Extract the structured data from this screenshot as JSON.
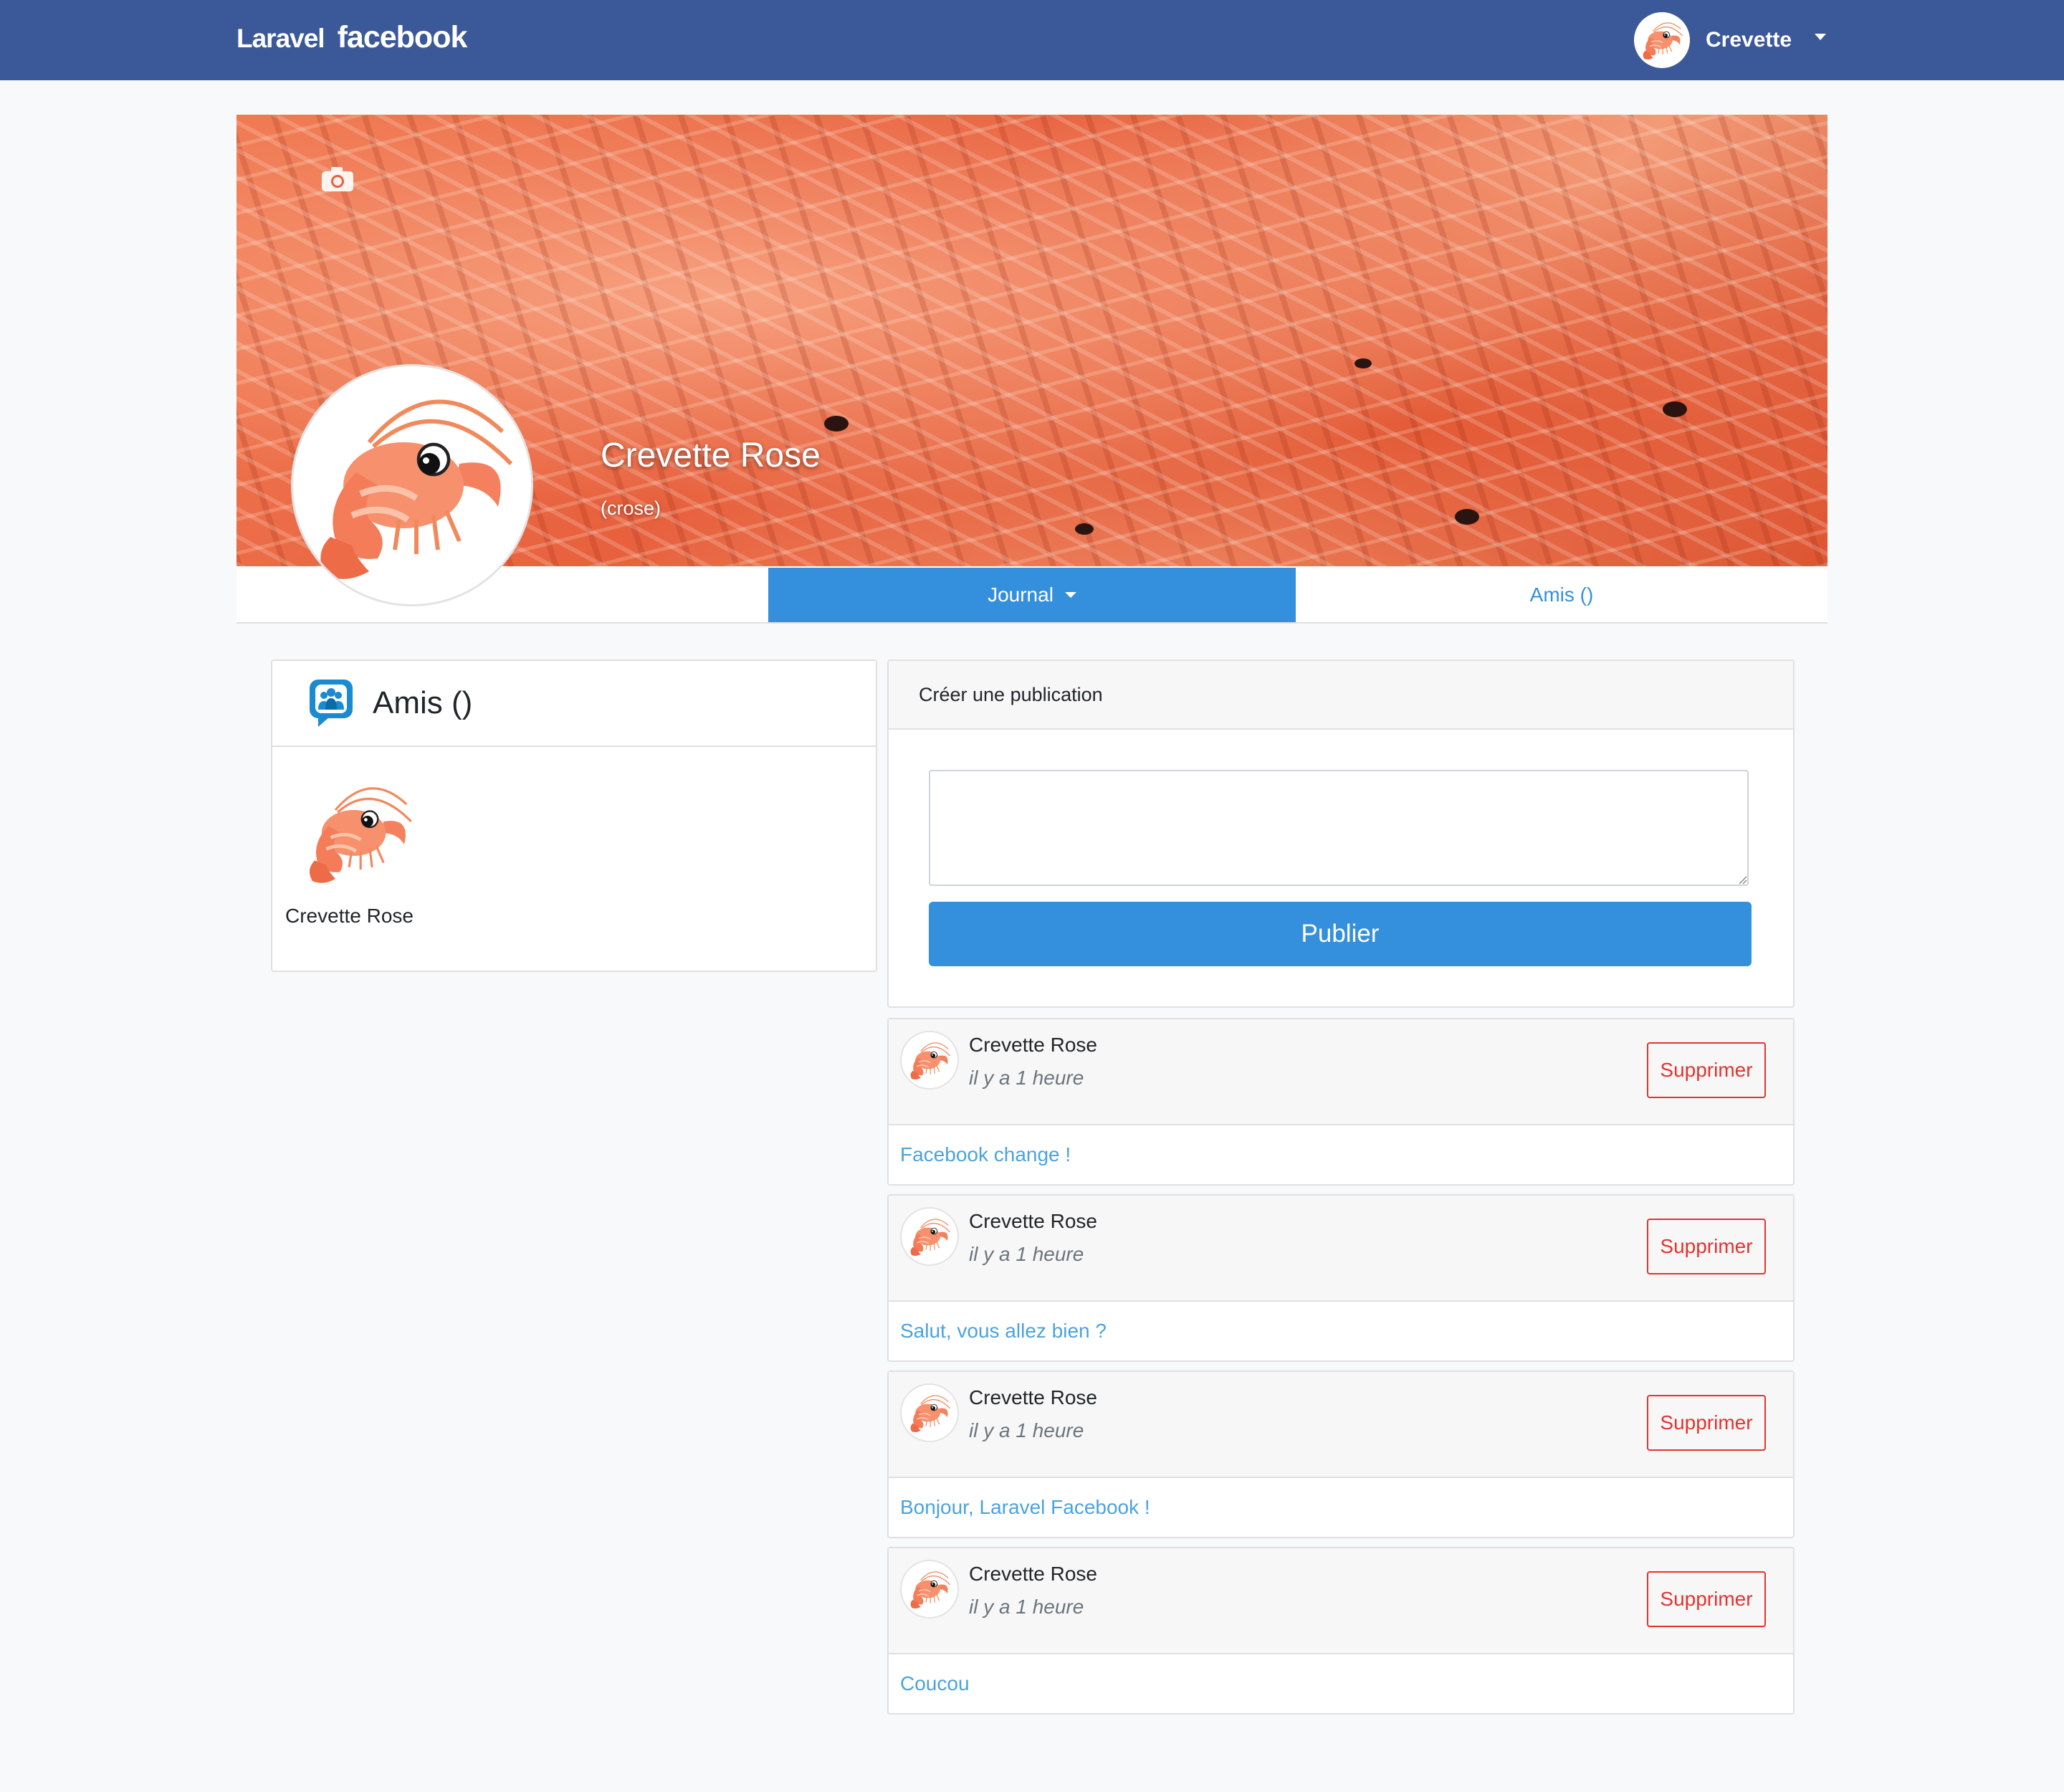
{
  "navbar": {
    "brand_part1": "Laravel",
    "brand_part2": "facebook",
    "username": "Crevette",
    "color": "#3b5998"
  },
  "profile": {
    "name": "Crevette Rose",
    "handle": "(crose)"
  },
  "tabs": {
    "journal": "Journal",
    "friends": "Amis ()"
  },
  "friends_card": {
    "title": "Amis ()",
    "friend_name": "Crevette Rose"
  },
  "create_post": {
    "header": "Créer une publication",
    "input_value": "",
    "publish_label": "Publier"
  },
  "posts": [
    {
      "author": "Crevette Rose",
      "time": "il y a 1 heure",
      "content": "Facebook change !",
      "delete_label": "Supprimer"
    },
    {
      "author": "Crevette Rose",
      "time": "il y a 1 heure",
      "content": "Salut, vous allez bien ?",
      "delete_label": "Supprimer"
    },
    {
      "author": "Crevette Rose",
      "time": "il y a 1 heure",
      "content": "Bonjour, Laravel Facebook !",
      "delete_label": "Supprimer"
    },
    {
      "author": "Crevette Rose",
      "time": "il y a 1 heure",
      "content": "Coucou",
      "delete_label": "Supprimer"
    }
  ],
  "colors": {
    "primary": "#3490dc",
    "danger": "#e3342f",
    "link": "#4aa3df"
  },
  "icons": {
    "camera": "camera-icon",
    "friends": "friends-chat-icon",
    "avatar": "shrimp-icon"
  }
}
